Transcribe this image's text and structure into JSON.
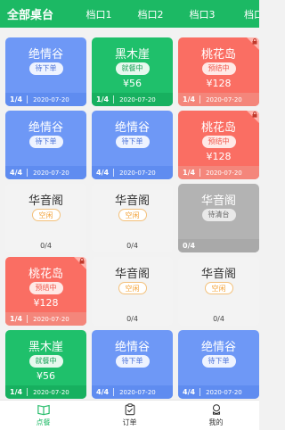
{
  "tabs": [
    {
      "label": "全部桌台",
      "active": true
    },
    {
      "label": "档口1",
      "active": false
    },
    {
      "label": "档口2",
      "active": false
    },
    {
      "label": "档口3",
      "active": false
    },
    {
      "label": "档口",
      "active": false
    }
  ],
  "tables": [
    {
      "name": "绝情谷",
      "status": "待下单",
      "color": "blue",
      "price": "",
      "seats": "1/4",
      "date": "2020-07-20",
      "locked": false
    },
    {
      "name": "黑木崖",
      "status": "就餐中",
      "color": "green",
      "price": "¥56",
      "seats": "1/4",
      "date": "2020-07-20",
      "locked": false
    },
    {
      "name": "桃花岛",
      "status": "预结中",
      "color": "red",
      "price": "¥128",
      "seats": "1/4",
      "date": "2020-07-20",
      "locked": true
    },
    {
      "name": "绝情谷",
      "status": "待下单",
      "color": "blue",
      "price": "",
      "seats": "4/4",
      "date": "2020-07-20",
      "locked": false
    },
    {
      "name": "绝情谷",
      "status": "待下单",
      "color": "blue",
      "price": "",
      "seats": "4/4",
      "date": "2020-07-20",
      "locked": false
    },
    {
      "name": "桃花岛",
      "status": "预结中",
      "color": "red",
      "price": "¥128",
      "seats": "1/4",
      "date": "2020-07-20",
      "locked": true
    },
    {
      "name": "华音阁",
      "status": "空闲",
      "color": "gray",
      "price": "",
      "seats": "0/4",
      "date": "",
      "locked": false
    },
    {
      "name": "华音阁",
      "status": "空闲",
      "color": "gray",
      "price": "",
      "seats": "0/4",
      "date": "",
      "locked": false
    },
    {
      "name": "华音阁",
      "status": "待清台",
      "color": "darkgray",
      "price": "",
      "seats": "0/4",
      "date": "",
      "locked": false
    },
    {
      "name": "桃花岛",
      "status": "预结中",
      "color": "red",
      "price": "¥128",
      "seats": "1/4",
      "date": "2020-07-20",
      "locked": true
    },
    {
      "name": "华音阁",
      "status": "空闲",
      "color": "gray",
      "price": "",
      "seats": "0/4",
      "date": "",
      "locked": false
    },
    {
      "name": "华音阁",
      "status": "空闲",
      "color": "gray",
      "price": "",
      "seats": "0/4",
      "date": "",
      "locked": false
    },
    {
      "name": "黑木崖",
      "status": "就餐中",
      "color": "green",
      "price": "¥56",
      "seats": "1/4",
      "date": "2020-07-20",
      "locked": false
    },
    {
      "name": "绝情谷",
      "status": "待下单",
      "color": "blue",
      "price": "",
      "seats": "4/4",
      "date": "2020-07-20",
      "locked": false
    },
    {
      "name": "绝情谷",
      "status": "待下单",
      "color": "blue",
      "price": "",
      "seats": "4/4",
      "date": "2020-07-20",
      "locked": false
    }
  ],
  "bottom_nav": [
    {
      "label": "点餐",
      "icon": "book-icon",
      "active": true
    },
    {
      "label": "订单",
      "icon": "clipboard-icon",
      "active": false
    },
    {
      "label": "我的",
      "icon": "user-icon",
      "active": false
    }
  ],
  "colors": {
    "accent": "#1cb964",
    "blue": "#6e98f6",
    "green": "#1fc06b",
    "red": "#fa6e63",
    "idle": "#f3f3f3",
    "cleaning": "#b3b3b3"
  }
}
